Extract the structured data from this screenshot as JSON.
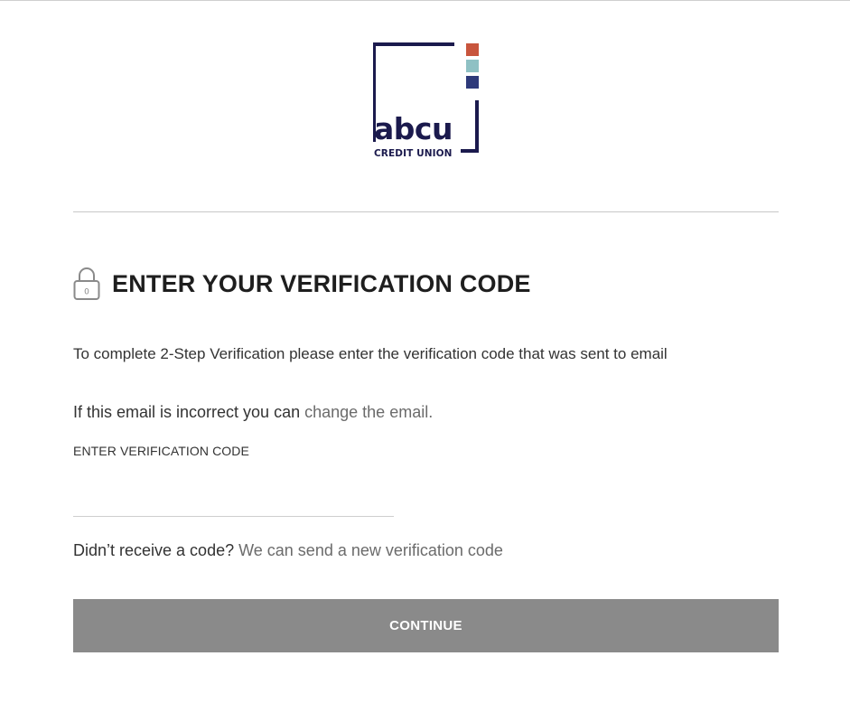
{
  "brand": {
    "name": "abcu",
    "subtitle": "CREDIT UNION",
    "colors": {
      "navy": "#1b1a4d",
      "red": "#c8553d",
      "teal": "#8fc1c4",
      "indigo": "#2e3a7a"
    }
  },
  "header": {
    "title": "ENTER YOUR VERIFICATION CODE",
    "icon": "lock-icon"
  },
  "body": {
    "instruction": "To complete 2-Step Verification please enter the verification code that was sent to email",
    "email_prefix": "If this email is incorrect you can ",
    "email_link": "change the email."
  },
  "form": {
    "code_label": "ENTER VERIFICATION CODE",
    "code_value": "",
    "code_placeholder": ""
  },
  "resend": {
    "prefix": "Didn’t receive a code? ",
    "link": "We can send a new verification code"
  },
  "actions": {
    "continue_label": "CONTINUE",
    "continue_color": "#8a8a8a"
  }
}
